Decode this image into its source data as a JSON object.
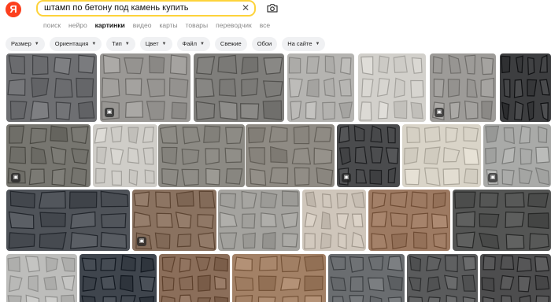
{
  "header": {
    "logo_letter": "Я",
    "search_value": "штамп по бетону под камень купить",
    "clear_icon": "close-icon",
    "camera_icon": "camera-icon"
  },
  "tabs": [
    {
      "label": "поиск",
      "active": false
    },
    {
      "label": "нейро",
      "active": false
    },
    {
      "label": "картинки",
      "active": true
    },
    {
      "label": "видео",
      "active": false
    },
    {
      "label": "карты",
      "active": false
    },
    {
      "label": "товары",
      "active": false
    },
    {
      "label": "переводчик",
      "active": false
    },
    {
      "label": "все",
      "active": false
    }
  ],
  "filters": [
    {
      "label": "Размер",
      "dropdown": true
    },
    {
      "label": "Ориентация",
      "dropdown": true
    },
    {
      "label": "Тип",
      "dropdown": true
    },
    {
      "label": "Цвет",
      "dropdown": true
    },
    {
      "label": "Файл",
      "dropdown": true
    },
    {
      "label": "Свежие",
      "dropdown": false
    },
    {
      "label": "Обои",
      "dropdown": false
    },
    {
      "label": "На сайте",
      "dropdown": true
    }
  ],
  "colors": {
    "accent_yellow": "#fdd33b",
    "logo_red": "#fc3f1d",
    "chip_bg": "#f0f1f3"
  },
  "results": [
    [
      {
        "desc": "dark-grey-slab-stamp",
        "color": "#6e6f72",
        "shop": false
      },
      {
        "desc": "grey-brick-wall-stamp",
        "color": "#9a9895",
        "shop": true
      },
      {
        "desc": "grey-flagstone-stamp",
        "color": "#7f7e7b",
        "shop": false
      },
      {
        "desc": "light-grey-stone-mat",
        "color": "#b5b4b1",
        "shop": false
      },
      {
        "desc": "white-rubble-panel",
        "color": "#d2d0cb",
        "shop": false
      },
      {
        "desc": "round-stone-tiles",
        "color": "#9d9b98",
        "shop": true
      },
      {
        "desc": "black-stone-mat",
        "color": "#3d3e40",
        "shop": false
      }
    ],
    [
      {
        "desc": "grey-square-slab-stamp",
        "color": "#777670",
        "shop": true
      },
      {
        "desc": "white-stone-panel",
        "color": "#cfcdc8",
        "shop": false
      },
      {
        "desc": "grey-and-yellow-paving",
        "color": "#8c8a84",
        "shop": false
      },
      {
        "desc": "cobblestone-floor",
        "color": "#8f8b84",
        "shop": false
      },
      {
        "desc": "black-flagstone-stamp",
        "color": "#4a4b4d",
        "shop": true
      },
      {
        "desc": "cream-brick-panels",
        "color": "#d9d4c8",
        "shop": false
      },
      {
        "desc": "grey-stone-stamp-blue-bg",
        "color": "#a9aaa8",
        "shop": true
      }
    ],
    [
      {
        "desc": "blue-grey-brick-stamp",
        "color": "#4f5359",
        "shop": false
      },
      {
        "desc": "brown-stone-stamp",
        "color": "#8a7260",
        "shop": true
      },
      {
        "desc": "grey-cross-stamp",
        "color": "#a4a39f",
        "shop": false
      },
      {
        "desc": "orange-stamp-set",
        "color": "#cfc6bb",
        "shop": false
      },
      {
        "desc": "terracotta-flagstone",
        "color": "#9d7a62",
        "shop": false
      },
      {
        "desc": "dark-slab-tiles",
        "color": "#545554",
        "shop": false
      }
    ],
    [
      {
        "desc": "light-grey-stone-mat",
        "color": "#bdbdbb",
        "shop": false
      },
      {
        "desc": "dark-blue-stone-mat",
        "color": "#3f454d",
        "shop": false
      },
      {
        "desc": "brown-cut-stone",
        "color": "#8b6e5a",
        "shop": false
      },
      {
        "desc": "tan-flagstone",
        "color": "#a38166",
        "shop": false
      },
      {
        "desc": "grey-brick-stamp",
        "color": "#6a6d70",
        "shop": false
      },
      {
        "desc": "dark-flagstone",
        "color": "#5a5b5c",
        "shop": false
      },
      {
        "desc": "dark-stone-slab",
        "color": "#4d4d4e",
        "shop": false
      }
    ]
  ]
}
